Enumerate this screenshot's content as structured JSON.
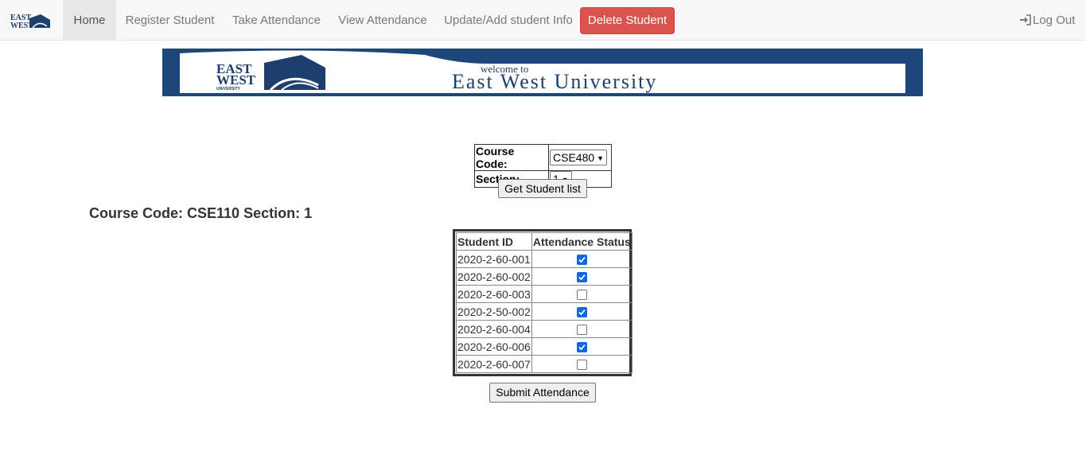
{
  "navbar": {
    "brand_lines": [
      "EAST",
      "WEST"
    ],
    "items": [
      {
        "label": "Home",
        "active": true
      },
      {
        "label": "Register Student",
        "active": false
      },
      {
        "label": "Take Attendance",
        "active": false
      },
      {
        "label": "View Attendance",
        "active": false
      },
      {
        "label": "Update/Add student Info",
        "active": false
      }
    ],
    "delete_label": "Delete Student",
    "logout_label": "Log Out",
    "logout_icon": "log-in-icon"
  },
  "banner": {
    "logo_lines": [
      "EAST",
      "WEST",
      "UNIVERSITY"
    ],
    "welcome": "welcome to",
    "university": "East West University",
    "colors": {
      "frame": "#1c4778"
    }
  },
  "selector": {
    "course_label": "Course Code:",
    "course_value": "CSE480",
    "section_label": "Section:",
    "section_value": "1",
    "submit_label": "Get Student list"
  },
  "heading": "Course Code: CSE110 Section: 1",
  "attendance": {
    "columns": [
      "Student ID",
      "Attendance Status"
    ],
    "rows": [
      {
        "id": "2020-2-60-001",
        "present": true
      },
      {
        "id": "2020-2-60-002",
        "present": true
      },
      {
        "id": "2020-2-60-003",
        "present": false
      },
      {
        "id": "2020-2-50-002",
        "present": true
      },
      {
        "id": "2020-2-60-004",
        "present": false
      },
      {
        "id": "2020-2-60-006",
        "present": true
      },
      {
        "id": "2020-2-60-007",
        "present": false
      }
    ],
    "submit_label": "Submit Attendance"
  },
  "colors": {
    "danger": "#d9534f",
    "checkbox": "#0b68e0",
    "nav_bg": "#f8f8f8"
  }
}
